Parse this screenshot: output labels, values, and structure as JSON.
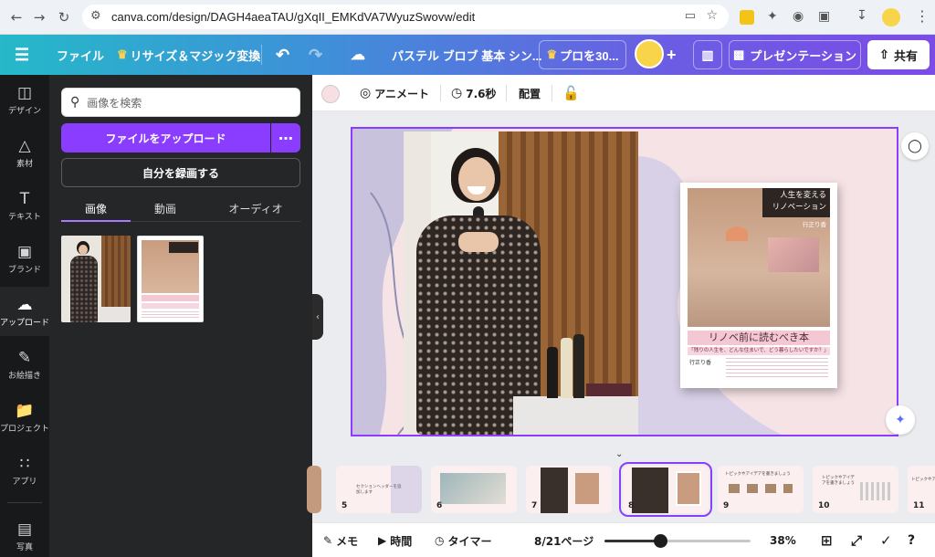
{
  "browser": {
    "url": "canva.com/design/DAGH4aeaTAU/gXqII_EMKdVA7WyuzSwovw/edit"
  },
  "topbar": {
    "file_label": "ファイル",
    "resize_label": "リサイズ＆マジック変換",
    "design_title": "パステル ブロブ 基本 シン...",
    "pro_label": "プロを30...",
    "present_label": "プレゼンテーション",
    "share_label": "共有"
  },
  "rail": {
    "items": [
      {
        "label": "デザイン",
        "icon": "design-icon"
      },
      {
        "label": "素材",
        "icon": "elements-icon"
      },
      {
        "label": "テキスト",
        "icon": "text-icon"
      },
      {
        "label": "ブランド",
        "icon": "brand-icon"
      },
      {
        "label": "アップロード",
        "icon": "upload-icon"
      },
      {
        "label": "お絵描き",
        "icon": "draw-icon"
      },
      {
        "label": "プロジェクト",
        "icon": "projects-icon"
      },
      {
        "label": "アプリ",
        "icon": "apps-icon"
      },
      {
        "label": "写真",
        "icon": "photos-icon"
      }
    ]
  },
  "panel": {
    "search_placeholder": "画像を検索",
    "upload_label": "ファイルをアップロード",
    "record_label": "自分を録画する",
    "tabs": [
      "画像",
      "動画",
      "オーディオ"
    ]
  },
  "editor_toolbar": {
    "animate_label": "アニメート",
    "duration_label": "7.6秒",
    "position_label": "配置"
  },
  "slide": {
    "book_title_1": "人生を変える",
    "book_title_2": "リノベーション",
    "book_author": "行正り香",
    "book_headline": "リノベ前に読むべき本",
    "book_subtitle": "「残りの人生を、どんな住まいで、どう暮らしたいですか？」",
    "book_author2": "行正り香"
  },
  "filmstrip": {
    "slides": [
      {
        "num": "5",
        "text": "セクションヘッダーを追加します"
      },
      {
        "num": "6",
        "text": ""
      },
      {
        "num": "7",
        "text": ""
      },
      {
        "num": "8",
        "text": ""
      },
      {
        "num": "9",
        "text": "トピックやアイデアを書きましょう"
      },
      {
        "num": "10",
        "text": "トピックやアイデアを書きましょう"
      },
      {
        "num": "11",
        "text": "トピックやアイデアを書きましょう"
      }
    ]
  },
  "bottombar": {
    "notes_label": "メモ",
    "time_label": "時間",
    "timer_label": "タイマー",
    "page_label": "8/21ページ",
    "zoom_label": "38%",
    "zoom_fraction": 0.38
  },
  "colors": {
    "accent": "#8b3dff",
    "slide_bg": "#f6e3e6",
    "blob": "#c9c2dc"
  }
}
